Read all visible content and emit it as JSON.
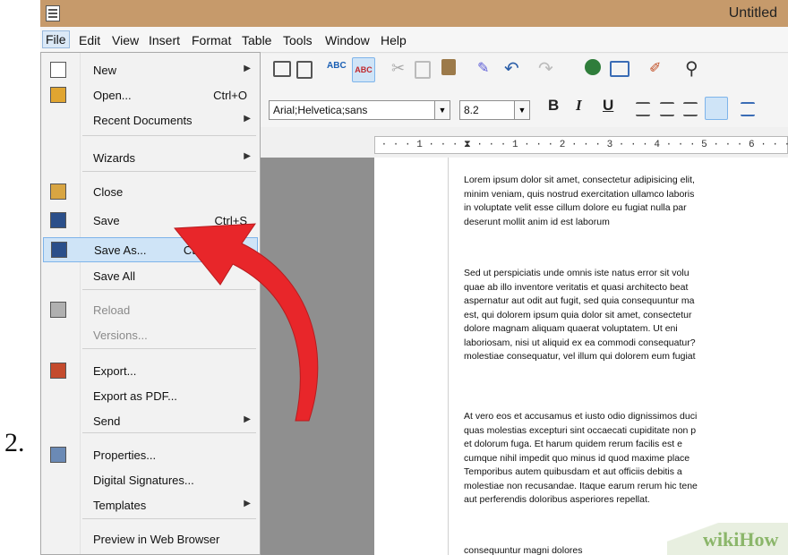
{
  "step_number": "2.",
  "window": {
    "title": "Untitled"
  },
  "menubar": [
    "File",
    "Edit",
    "View",
    "Insert",
    "Format",
    "Table",
    "Tools",
    "Window",
    "Help"
  ],
  "file_menu": {
    "items": [
      {
        "label": "New",
        "shortcut": "",
        "submenu": true,
        "disabled": false,
        "highlighted": false,
        "icon": "new-document-icon"
      },
      {
        "label": "Open...",
        "shortcut": "Ctrl+O",
        "submenu": false,
        "disabled": false,
        "highlighted": false,
        "icon": "open-folder-icon"
      },
      {
        "label": "Recent Documents",
        "shortcut": "",
        "submenu": true,
        "disabled": false,
        "highlighted": false,
        "icon": ""
      },
      {
        "label": "Wizards",
        "shortcut": "",
        "submenu": true,
        "disabled": false,
        "highlighted": false,
        "icon": ""
      },
      {
        "label": "Close",
        "shortcut": "",
        "submenu": false,
        "disabled": false,
        "highlighted": false,
        "icon": "close-document-icon"
      },
      {
        "label": "Save",
        "shortcut": "Ctrl+S",
        "submenu": false,
        "disabled": false,
        "highlighted": false,
        "icon": "save-icon"
      },
      {
        "label": "Save As...",
        "shortcut": "Ctrl+Shift+S",
        "submenu": false,
        "disabled": false,
        "highlighted": true,
        "icon": "save-as-icon"
      },
      {
        "label": "Save All",
        "shortcut": "",
        "submenu": false,
        "disabled": false,
        "highlighted": false,
        "icon": ""
      },
      {
        "label": "Reload",
        "shortcut": "",
        "submenu": false,
        "disabled": true,
        "highlighted": false,
        "icon": "reload-icon"
      },
      {
        "label": "Versions...",
        "shortcut": "",
        "submenu": false,
        "disabled": true,
        "highlighted": false,
        "icon": ""
      },
      {
        "label": "Export...",
        "shortcut": "",
        "submenu": false,
        "disabled": false,
        "highlighted": false,
        "icon": "export-icon"
      },
      {
        "label": "Export as PDF...",
        "shortcut": "",
        "submenu": false,
        "disabled": false,
        "highlighted": false,
        "icon": ""
      },
      {
        "label": "Send",
        "shortcut": "",
        "submenu": true,
        "disabled": false,
        "highlighted": false,
        "icon": ""
      },
      {
        "label": "Properties...",
        "shortcut": "",
        "submenu": false,
        "disabled": false,
        "highlighted": false,
        "icon": "properties-icon"
      },
      {
        "label": "Digital Signatures...",
        "shortcut": "",
        "submenu": false,
        "disabled": false,
        "highlighted": false,
        "icon": ""
      },
      {
        "label": "Templates",
        "shortcut": "",
        "submenu": true,
        "disabled": false,
        "highlighted": false,
        "icon": ""
      },
      {
        "label": "Preview in Web Browser",
        "shortcut": "",
        "submenu": false,
        "disabled": false,
        "highlighted": false,
        "icon": ""
      }
    ]
  },
  "formatting": {
    "font_name": "Arial;Helvetica;sans",
    "font_size": "8.2",
    "bold": "B",
    "italic": "I",
    "underline": "U"
  },
  "ruler_text": " · · · 1 · · · ⧗ · · · 1 · · · 2 · · · 3 · · · 4 · · · 5 · · · 6 · · · 7",
  "document": {
    "paragraphs": [
      "Lorem ipsum dolor sit amet, consectetur adipisicing elit,\nminim veniam, quis nostrud exercitation ullamco laboris\nin voluptate velit esse cillum dolore eu fugiat nulla par\ndeserunt mollit anim id est laborum",
      "Sed ut perspiciatis unde omnis iste natus error sit volu\nquae ab illo inventore veritatis et quasi architecto beat\naspernatur aut odit aut fugit, sed quia consequuntur ma\nest, qui dolorem ipsum quia dolor sit amet, consectetur\ndolore magnam aliquam quaerat voluptatem. Ut eni\nlaboriosam, nisi ut aliquid ex ea commodi consequatur?\nmolestiae consequatur, vel illum qui dolorem eum fugiat",
      "At vero eos et accusamus et iusto odio dignissimos duci\nquas molestias excepturi sint occaecati cupiditate non p\net dolorum fuga. Et harum quidem rerum facilis est e\ncumque nihil impedit quo minus id quod maxime place\nTemporibus autem quibusdam et aut officiis debitis a\nmolestiae non recusandae. Itaque earum rerum hic tene\naut perferendis doloribus asperiores repellat.",
      "consequuntur magni dolores"
    ]
  },
  "watermark": "wikiHow",
  "colors": {
    "titlebar": "#c69a6b",
    "highlight": "#cfe4f7",
    "arrow": "#e8262a"
  }
}
